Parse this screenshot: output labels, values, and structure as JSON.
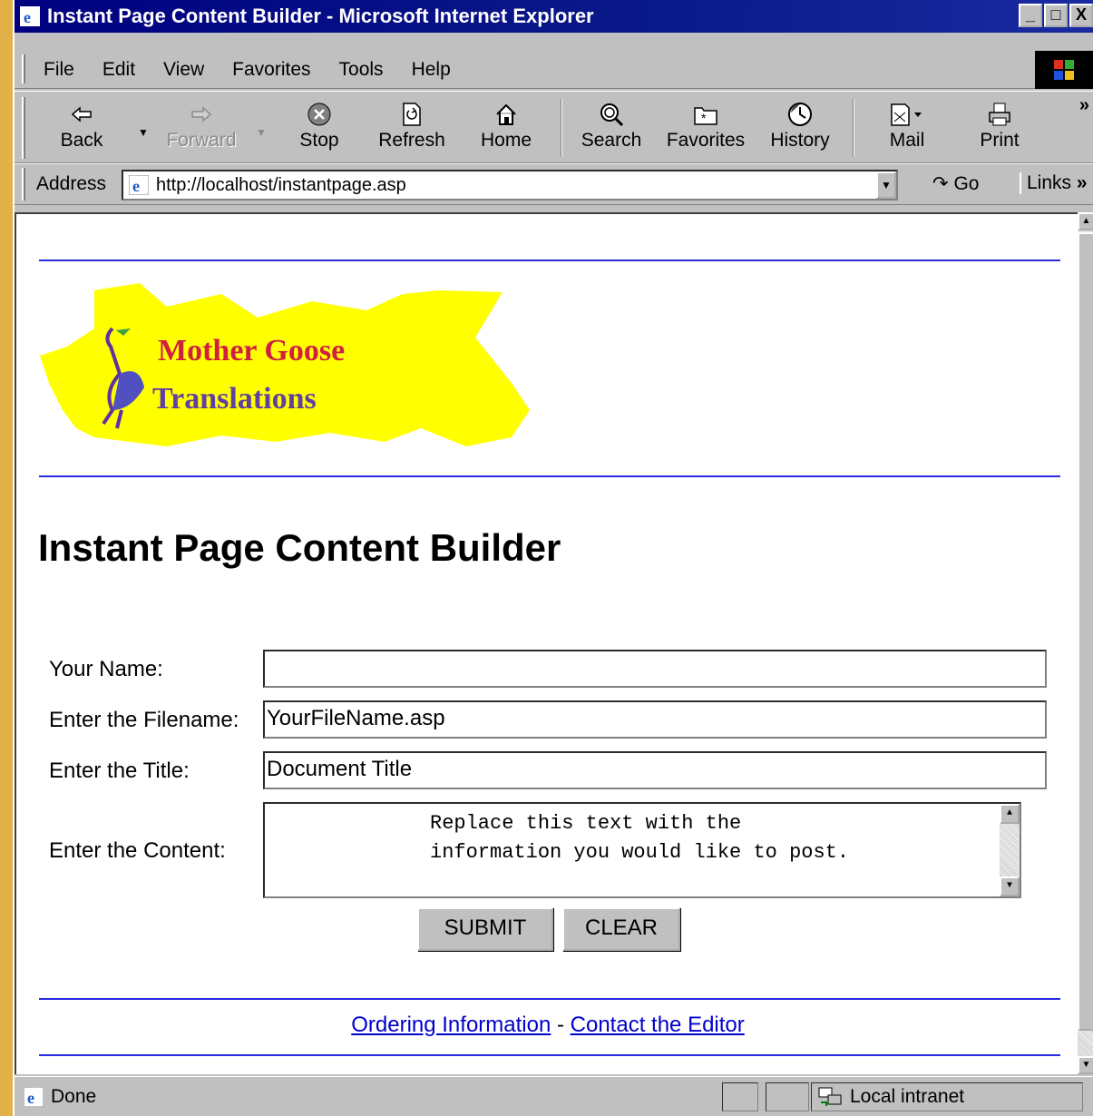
{
  "window": {
    "title": "Instant Page Content Builder - Microsoft Internet Explorer",
    "controls": [
      "_",
      "□",
      "X"
    ]
  },
  "menu": [
    "File",
    "Edit",
    "View",
    "Favorites",
    "Tools",
    "Help"
  ],
  "toolbar": {
    "back": "Back",
    "forward": "Forward",
    "stop": "Stop",
    "refresh": "Refresh",
    "home": "Home",
    "search": "Search",
    "favorites": "Favorites",
    "history": "History",
    "mail": "Mail",
    "print": "Print",
    "more": "»"
  },
  "address": {
    "label": "Address",
    "url": "http://localhost/instantpage.asp",
    "go": "Go",
    "links": "Links",
    "links_more": "»"
  },
  "page": {
    "logo_line1": "Mother Goose",
    "logo_line2": "Translations",
    "title": "Instant Page Content Builder",
    "form": {
      "name_label": "Your Name:",
      "name_value": "",
      "filename_label": "Enter the Filename:",
      "filename_value": "YourFileName.asp",
      "title_label": "Enter the Title:",
      "title_value": "Document Title",
      "content_label": "Enter the Content:",
      "content_value": "Replace this text with the\ninformation you would like to post.",
      "submit": "SUBMIT",
      "clear": "CLEAR"
    },
    "footer": {
      "ordering": "Ordering Information",
      "separator": " - ",
      "contact": "Contact the Editor"
    }
  },
  "status": {
    "text": "Done",
    "zone": "Local intranet"
  },
  "colors": {
    "titlebar": "#000080",
    "rule": "#2a2ae0",
    "link": "#0000cc",
    "logo_bg": "#ffff00",
    "desktop": "#e8b84a"
  }
}
